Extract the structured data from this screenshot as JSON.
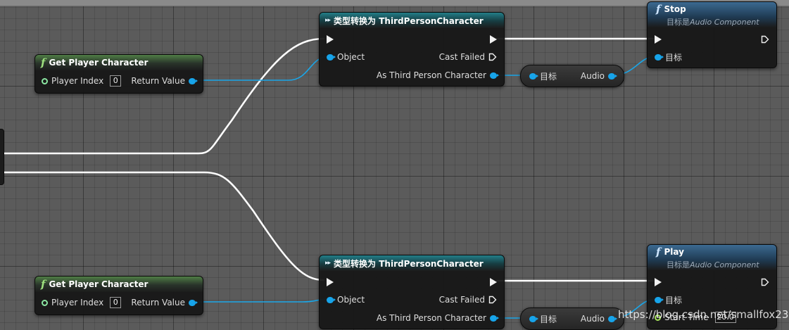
{
  "colors": {
    "exec_wire": "#ffffff",
    "object_wire": "#1aa6e8",
    "func_header": "#4f7d45",
    "cast_header": "#237e88",
    "call_header": "#3c6a91"
  },
  "nodes": {
    "get_player_1": {
      "title": "Get Player Character",
      "in_label": "Player Index",
      "in_value": "0",
      "out_label": "Return Value"
    },
    "get_player_2": {
      "title": "Get Player Character",
      "in_label": "Player Index",
      "in_value": "0",
      "out_label": "Return Value"
    },
    "cast_1": {
      "glyph": "▸▸",
      "title": "类型转换为 ThirdPersonCharacter",
      "object_label": "Object",
      "cast_failed_label": "Cast Failed",
      "as_label": "As Third Person Character"
    },
    "cast_2": {
      "glyph": "▸▸",
      "title": "类型转换为 ThirdPersonCharacter",
      "object_label": "Object",
      "cast_failed_label": "Cast Failed",
      "as_label": "As Third Person Character"
    },
    "get_audio_1": {
      "target_label": "目标",
      "out_label": "Audio"
    },
    "get_audio_2": {
      "target_label": "目标",
      "out_label": "Audio"
    },
    "stop": {
      "title": "Stop",
      "subtitle_prefix": "目标是",
      "subtitle_target": "Audio Component",
      "target_label": "目标"
    },
    "play": {
      "title": "Play",
      "subtitle_prefix": "目标是",
      "subtitle_target": "Audio Component",
      "target_label": "目标",
      "start_label": "Start Time",
      "start_value": "20.0"
    }
  },
  "watermark": "https://blog.csdn.net/smallfox233"
}
